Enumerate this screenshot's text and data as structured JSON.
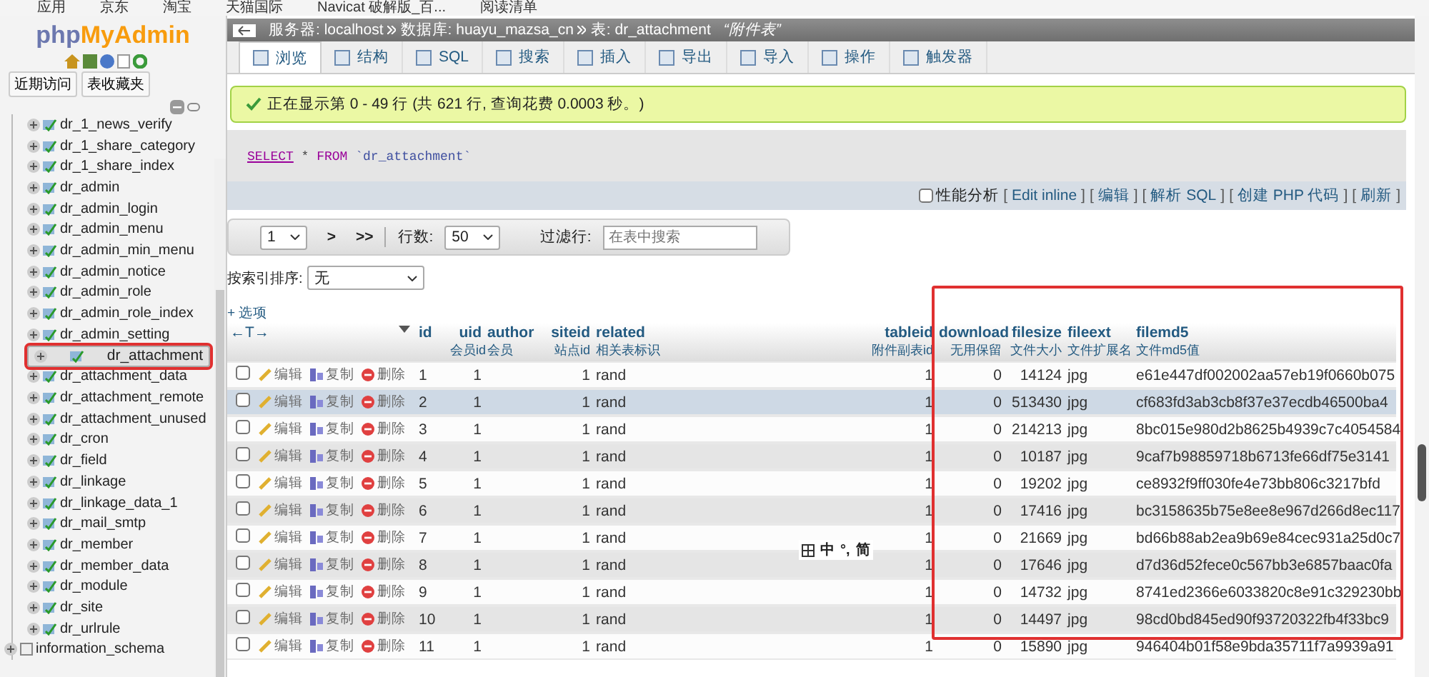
{
  "bookmarks": [
    "应用",
    "京东",
    "淘宝",
    "天猫国际",
    "Navicat 破解版_百...",
    "阅读清单"
  ],
  "sidebar": {
    "logo_php": "php",
    "logo_admin": "MyAdmin",
    "buttons": [
      "近期访问",
      "表收藏夹"
    ],
    "tables": [
      {
        "label": "dr_1_news_verify",
        "selected": false,
        "marked": false
      },
      {
        "label": "dr_1_share_category",
        "selected": false,
        "marked": false
      },
      {
        "label": "dr_1_share_index",
        "selected": false,
        "marked": false
      },
      {
        "label": "dr_admin",
        "selected": false,
        "marked": false
      },
      {
        "label": "dr_admin_login",
        "selected": false,
        "marked": false
      },
      {
        "label": "dr_admin_menu",
        "selected": false,
        "marked": false
      },
      {
        "label": "dr_admin_min_menu",
        "selected": false,
        "marked": false
      },
      {
        "label": "dr_admin_notice",
        "selected": false,
        "marked": false
      },
      {
        "label": "dr_admin_role",
        "selected": false,
        "marked": false
      },
      {
        "label": "dr_admin_role_index",
        "selected": false,
        "marked": false
      },
      {
        "label": "dr_admin_setting",
        "selected": false,
        "marked": false
      },
      {
        "label": "dr_attachment",
        "selected": true,
        "marked": true
      },
      {
        "label": "dr_attachment_data",
        "selected": false,
        "marked": false
      },
      {
        "label": "dr_attachment_remote",
        "selected": false,
        "marked": false
      },
      {
        "label": "dr_attachment_unused",
        "selected": false,
        "marked": false
      },
      {
        "label": "dr_cron",
        "selected": false,
        "marked": false
      },
      {
        "label": "dr_field",
        "selected": false,
        "marked": false
      },
      {
        "label": "dr_linkage",
        "selected": false,
        "marked": false
      },
      {
        "label": "dr_linkage_data_1",
        "selected": false,
        "marked": false
      },
      {
        "label": "dr_mail_smtp",
        "selected": false,
        "marked": false
      },
      {
        "label": "dr_member",
        "selected": false,
        "marked": false
      },
      {
        "label": "dr_member_data",
        "selected": false,
        "marked": false
      },
      {
        "label": "dr_module",
        "selected": false,
        "marked": false
      },
      {
        "label": "dr_site",
        "selected": false,
        "marked": false
      },
      {
        "label": "dr_urlrule",
        "selected": false,
        "marked": false
      }
    ],
    "database": "information_schema"
  },
  "breadcrumb": {
    "server": "服务器: localhost",
    "database": "数据库: huayu_mazsa_cn",
    "table": "表: dr_attachment",
    "comment": "“附件表”"
  },
  "tabs": [
    {
      "label": "浏览",
      "selected": true
    },
    {
      "label": "结构",
      "selected": false
    },
    {
      "label": "SQL",
      "selected": false
    },
    {
      "label": "搜索",
      "selected": false
    },
    {
      "label": "插入",
      "selected": false
    },
    {
      "label": "导出",
      "selected": false
    },
    {
      "label": "导入",
      "selected": false
    },
    {
      "label": "操作",
      "selected": false
    },
    {
      "label": "触发器",
      "selected": false
    }
  ],
  "message": "正在显示第 0 - 49 行 (共 621 行, 查询花费 0.0003 秒。)",
  "sql": {
    "select": "SELECT",
    "star": "*",
    "from": "FROM",
    "table": "`dr_attachment`"
  },
  "sql_tools": {
    "profiling": {
      "label": "性能分析",
      "checked": false
    },
    "open": "[",
    "close": "]",
    "links": [
      "Edit inline",
      "编辑",
      "解析 SQL",
      "创建 PHP 代码",
      "刷新"
    ]
  },
  "pager": {
    "page": "1",
    "next": ">",
    "last": ">>",
    "rows_label": "行数:",
    "rows": "50",
    "filter_label": "过滤行:",
    "filter_placeholder": "在表中搜索"
  },
  "sort": {
    "label": "按索引排序:",
    "value": "无"
  },
  "options": "+ 选项",
  "column_resize": "←T→",
  "columns": [
    {
      "name": "id"
    },
    {
      "name": "uid",
      "comment": "会员id"
    },
    {
      "name": "author",
      "comment": "会员"
    },
    {
      "name": "siteid",
      "comment": "站点id"
    },
    {
      "name": "related",
      "comment": "相关表标识"
    },
    {
      "name": "tableid",
      "comment": "附件副表id"
    },
    {
      "name": "download",
      "comment": "无用保留"
    },
    {
      "name": "filesize",
      "comment": "文件大小"
    },
    {
      "name": "fileext",
      "comment": "文件扩展名"
    },
    {
      "name": "filemd5",
      "comment": "文件md5值"
    }
  ],
  "highlight_frame": true,
  "rows": [
    {
      "actions": [
        "编辑",
        "复制",
        "删除"
      ],
      "selected": false,
      "checked": false,
      "id": "1",
      "uid": "1",
      "siteid": "1",
      "related": "rand",
      "tableid": "1",
      "download": "0",
      "filesize": "14124",
      "fileext": "jpg",
      "filemd5": "e61e447df002002aa57eb19f0660b075"
    },
    {
      "actions": [
        "编辑",
        "复制",
        "删除"
      ],
      "selected": true,
      "checked": false,
      "id": "2",
      "uid": "1",
      "siteid": "1",
      "related": "rand",
      "tableid": "1",
      "download": "0",
      "filesize": "513430",
      "fileext": "jpg",
      "filemd5": "cf683fd3ab3cb8f37e37ecdb46500ba4"
    },
    {
      "actions": [
        "编辑",
        "复制",
        "删除"
      ],
      "selected": false,
      "checked": false,
      "id": "3",
      "uid": "1",
      "siteid": "1",
      "related": "rand",
      "tableid": "1",
      "download": "0",
      "filesize": "214213",
      "fileext": "jpg",
      "filemd5": "8bc015e980d2b8625b4939c7c4054584"
    },
    {
      "actions": [
        "编辑",
        "复制",
        "删除"
      ],
      "selected": false,
      "checked": false,
      "id": "4",
      "uid": "1",
      "siteid": "1",
      "related": "rand",
      "tableid": "1",
      "download": "0",
      "filesize": "10187",
      "fileext": "jpg",
      "filemd5": "9caf7b98859718b6713fe66df75e3141"
    },
    {
      "actions": [
        "编辑",
        "复制",
        "删除"
      ],
      "selected": false,
      "checked": false,
      "id": "5",
      "uid": "1",
      "siteid": "1",
      "related": "rand",
      "tableid": "1",
      "download": "0",
      "filesize": "19202",
      "fileext": "jpg",
      "filemd5": "ce8932f9ff030fe4e73bb806c3217bfd"
    },
    {
      "actions": [
        "编辑",
        "复制",
        "删除"
      ],
      "selected": false,
      "checked": false,
      "id": "6",
      "uid": "1",
      "siteid": "1",
      "related": "rand",
      "tableid": "1",
      "download": "0",
      "filesize": "17416",
      "fileext": "jpg",
      "filemd5": "bc3158635b75e8ee8e967d266d8ec117"
    },
    {
      "actions": [
        "编辑",
        "复制",
        "删除"
      ],
      "selected": false,
      "checked": false,
      "id": "7",
      "uid": "1",
      "siteid": "1",
      "related": "rand",
      "tableid": "1",
      "download": "0",
      "filesize": "21669",
      "fileext": "jpg",
      "filemd5": "bd66b88ab2ea9b69e84cec931a25d0c7"
    },
    {
      "actions": [
        "编辑",
        "复制",
        "删除"
      ],
      "selected": false,
      "checked": false,
      "id": "8",
      "uid": "1",
      "siteid": "1",
      "related": "rand",
      "tableid": "1",
      "download": "0",
      "filesize": "17646",
      "fileext": "jpg",
      "filemd5": "d7d36d52fece0c567bb3e6857baac0fa"
    },
    {
      "actions": [
        "编辑",
        "复制",
        "删除"
      ],
      "selected": false,
      "checked": false,
      "id": "9",
      "uid": "1",
      "siteid": "1",
      "related": "rand",
      "tableid": "1",
      "download": "0",
      "filesize": "14732",
      "fileext": "jpg",
      "filemd5": "8741ed2366e6033820c8e91c329230bb"
    },
    {
      "actions": [
        "编辑",
        "复制",
        "删除"
      ],
      "selected": false,
      "checked": false,
      "id": "10",
      "uid": "1",
      "siteid": "1",
      "related": "rand",
      "tableid": "1",
      "download": "0",
      "filesize": "14497",
      "fileext": "jpg",
      "filemd5": "98cd0bd845ed90f93720322fb4f33bc9"
    },
    {
      "actions": [
        "编辑",
        "复制",
        "删除"
      ],
      "selected": false,
      "checked": false,
      "id": "11",
      "uid": "1",
      "siteid": "1",
      "related": "rand",
      "tableid": "1",
      "download": "0",
      "filesize": "15890",
      "fileext": "jpg",
      "filemd5": "946404b01f58e9bda35711f7a9939a91"
    }
  ],
  "ime": [
    "中",
    "°,",
    "简"
  ]
}
